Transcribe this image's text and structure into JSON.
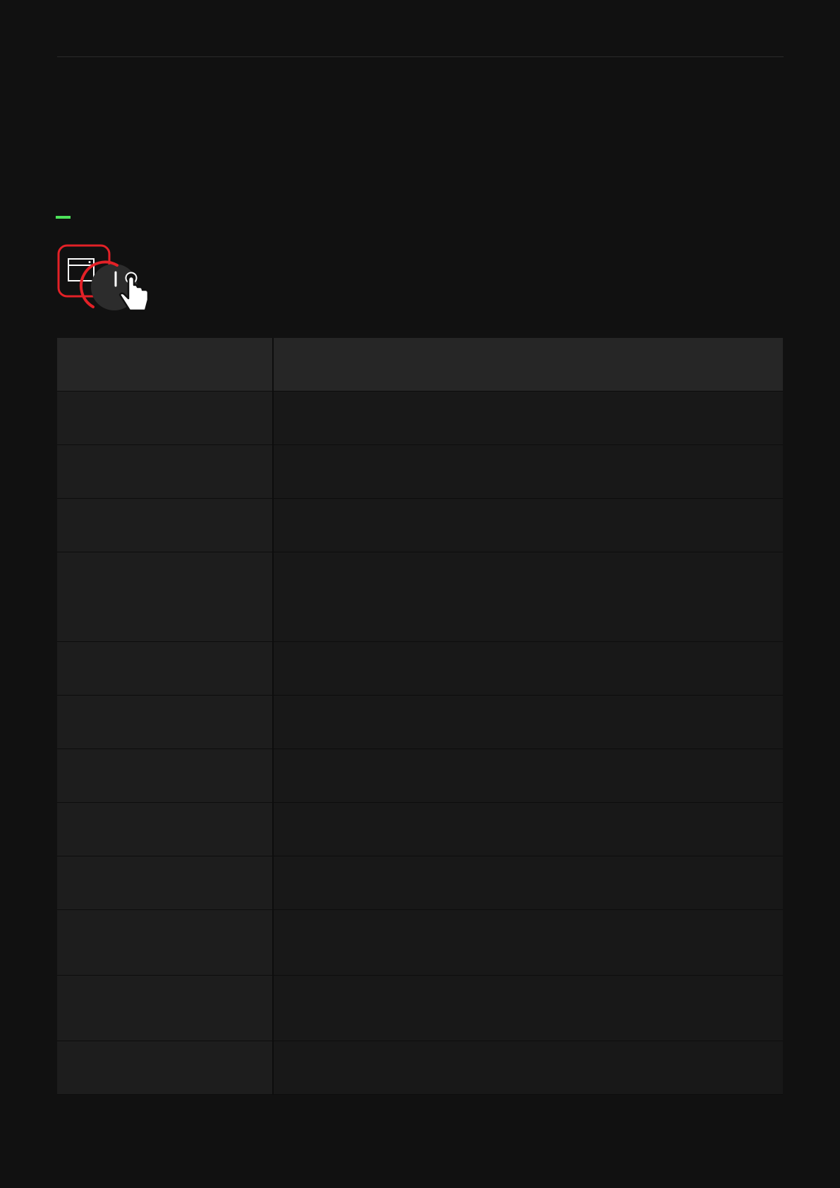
{
  "colors": {
    "background": "#111111",
    "accent": "#4de35a",
    "logo_red": "#e32127",
    "table_header": "#262626",
    "table_col_a": "#1d1d1d",
    "table_col_b": "#181818"
  },
  "logo": {
    "icon": "server-power-touch-icon"
  },
  "table": {
    "header": [
      "",
      ""
    ],
    "rows": [
      [
        "",
        ""
      ],
      [
        "",
        ""
      ],
      [
        "",
        ""
      ],
      [
        "",
        ""
      ],
      [
        "",
        ""
      ],
      [
        "",
        ""
      ],
      [
        "",
        ""
      ],
      [
        "",
        ""
      ],
      [
        "",
        ""
      ],
      [
        "",
        ""
      ],
      [
        "",
        ""
      ],
      [
        "",
        ""
      ]
    ]
  }
}
